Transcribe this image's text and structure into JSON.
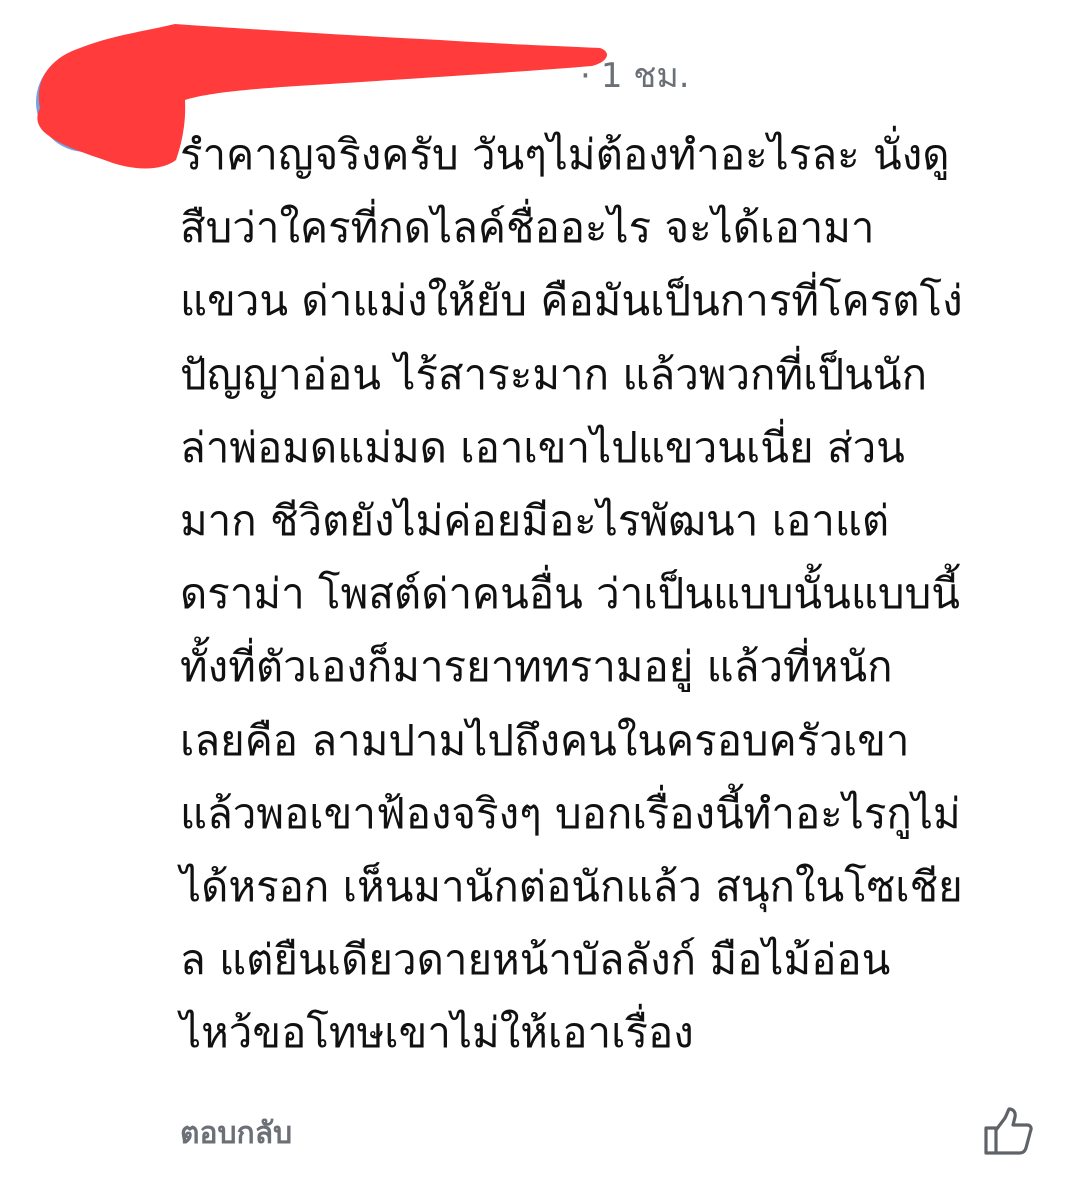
{
  "comment": {
    "timestamp": "1 ชม.",
    "separator": "·",
    "body_lines": [
      "รำคาญจริงครับ วันๆไม่ต้องทำอะไรละ นั่งดู",
      "สืบว่าใครที่กดไลค์ชื่ออะไร จะได้เอามา",
      "แขวน ด่าแม่งให้ยับ คือมันเป็นการที่โครตโง่",
      "ปัญญาอ่อน ไร้สาระมาก แล้วพวกที่เป็นนัก",
      "ล่าพ่อมดแม่มด เอาเขาไปแขวนเนี่ย ส่วน",
      "มาก ชีวิตยังไม่ค่อยมีอะไรพัฒนา เอาแต่",
      "ดราม่า โพสต์ด่าคนอื่น ว่าเป็นแบบนั้นแบบนี้",
      "ทั้งที่ตัวเองก็มารยาททรามอยู่ แล้วที่หนัก",
      "เลยคือ ลามปามไปถึงคนในครอบครัวเขา",
      "แล้วพอเขาฟ้องจริงๆ บอกเรื่องนี้ทำอะไรกูไม่",
      "ได้หรอก เห็นมานักต่อนักแล้ว สนุกในโซเชีย",
      "ล แต่ยืนเดียวดายหน้าบัลลังก์ มือไม้อ่อน",
      "ไหว้ขอโทษเขาไม่ให้เอาเรื่อง"
    ]
  },
  "actions": {
    "reply_label": "ตอบกลับ",
    "like_icon": "thumbs-up-icon"
  },
  "colors": {
    "redaction": "#ff3b3b",
    "avatar": "#6fa3e6",
    "meta_text": "#6b6f76",
    "body_text": "#111111"
  }
}
